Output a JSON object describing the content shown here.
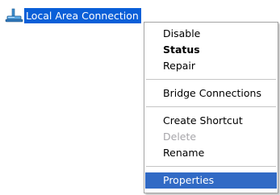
{
  "connection": {
    "label": "Local Area Connection",
    "icon": "network-connection-icon"
  },
  "context_menu": {
    "items": [
      {
        "label": "Disable",
        "state": "normal"
      },
      {
        "label": "Status",
        "state": "default-bold"
      },
      {
        "label": "Repair",
        "state": "normal"
      },
      {
        "label": "Bridge Connections",
        "state": "normal"
      },
      {
        "label": "Create Shortcut",
        "state": "normal"
      },
      {
        "label": "Delete",
        "state": "disabled"
      },
      {
        "label": "Rename",
        "state": "normal"
      },
      {
        "label": "Properties",
        "state": "highlighted"
      }
    ]
  },
  "colors": {
    "selection": "#0a5fd8",
    "menu_highlight": "#316ac5",
    "disabled_text": "#a7a6aa",
    "menu_border": "#a4a4a4"
  }
}
